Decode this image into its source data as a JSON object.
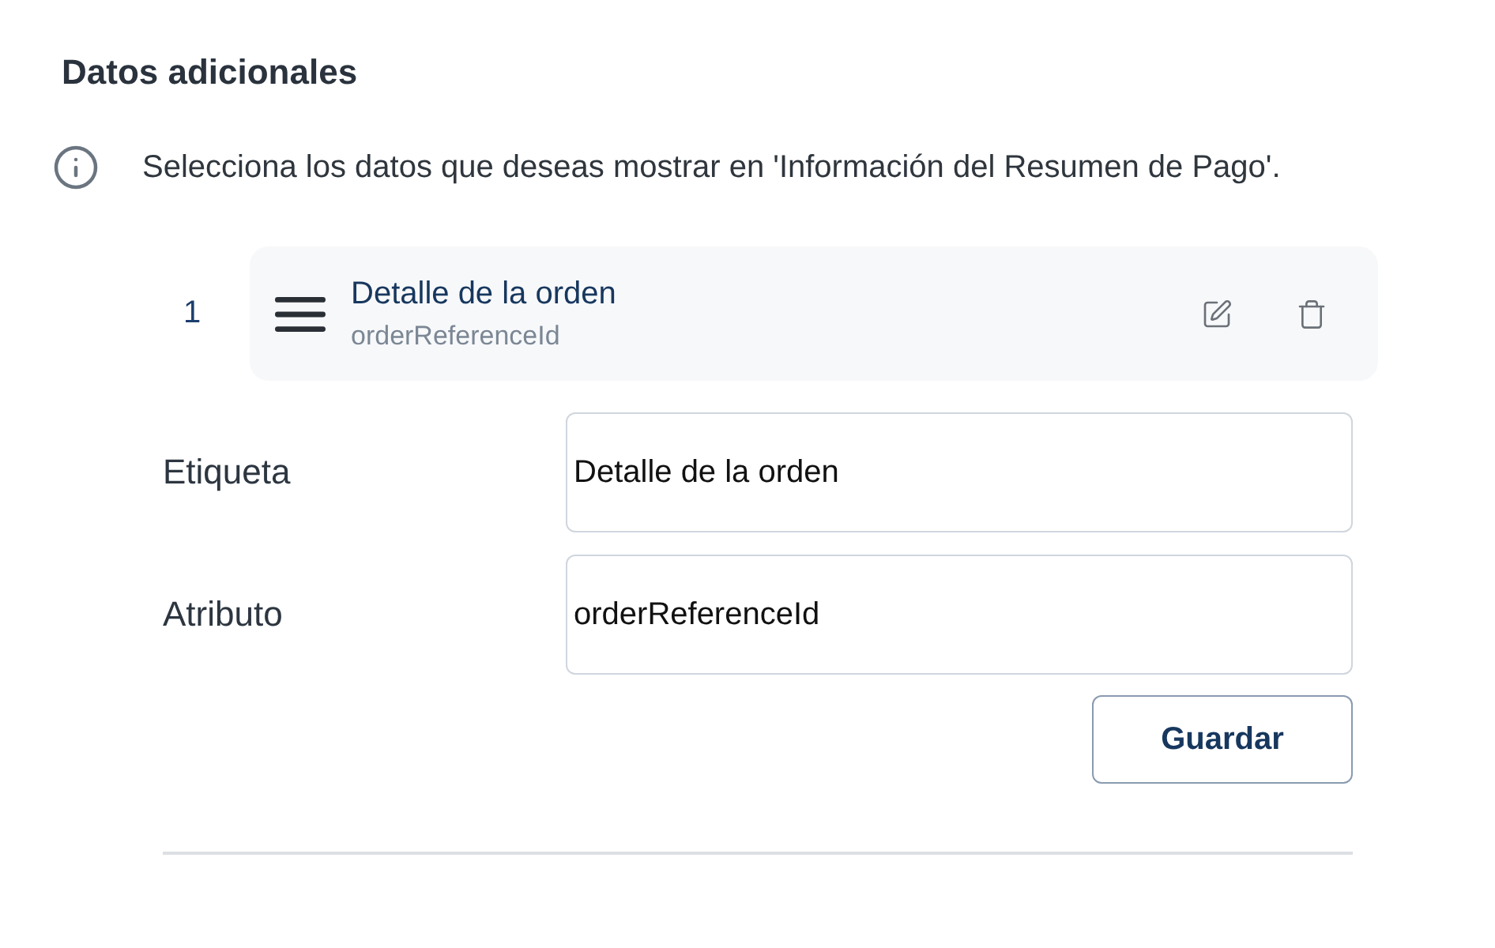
{
  "section": {
    "title": "Datos adicionales",
    "info": "Selecciona los datos que deseas mostrar en 'Información del Resumen de Pago'."
  },
  "items": [
    {
      "index": "1",
      "title": "Detalle de la orden",
      "subtitle": "orderReferenceId",
      "form": {
        "fields": [
          {
            "label": "Etiqueta",
            "value": "Detalle de la orden"
          },
          {
            "label": "Atributo",
            "value": "orderReferenceId"
          }
        ],
        "save_button": "Guardar"
      }
    }
  ]
}
